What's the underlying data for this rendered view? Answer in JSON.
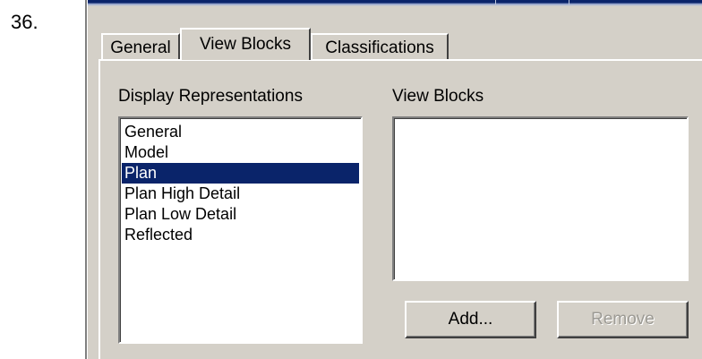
{
  "step_number": "36.",
  "tabs": [
    {
      "label": "General",
      "active": false
    },
    {
      "label": "View Blocks",
      "active": true
    },
    {
      "label": "Classifications",
      "active": false
    }
  ],
  "display_representations": {
    "label": "Display Representations",
    "items": [
      "General",
      "Model",
      "Plan",
      "Plan High Detail",
      "Plan Low Detail",
      "Reflected"
    ],
    "selected": "Plan"
  },
  "view_blocks": {
    "label": "View Blocks",
    "items": []
  },
  "buttons": {
    "add": "Add...",
    "remove": "Remove"
  },
  "colors": {
    "dialog_bg": "#d4d0c8",
    "selection": "#0a246a"
  }
}
